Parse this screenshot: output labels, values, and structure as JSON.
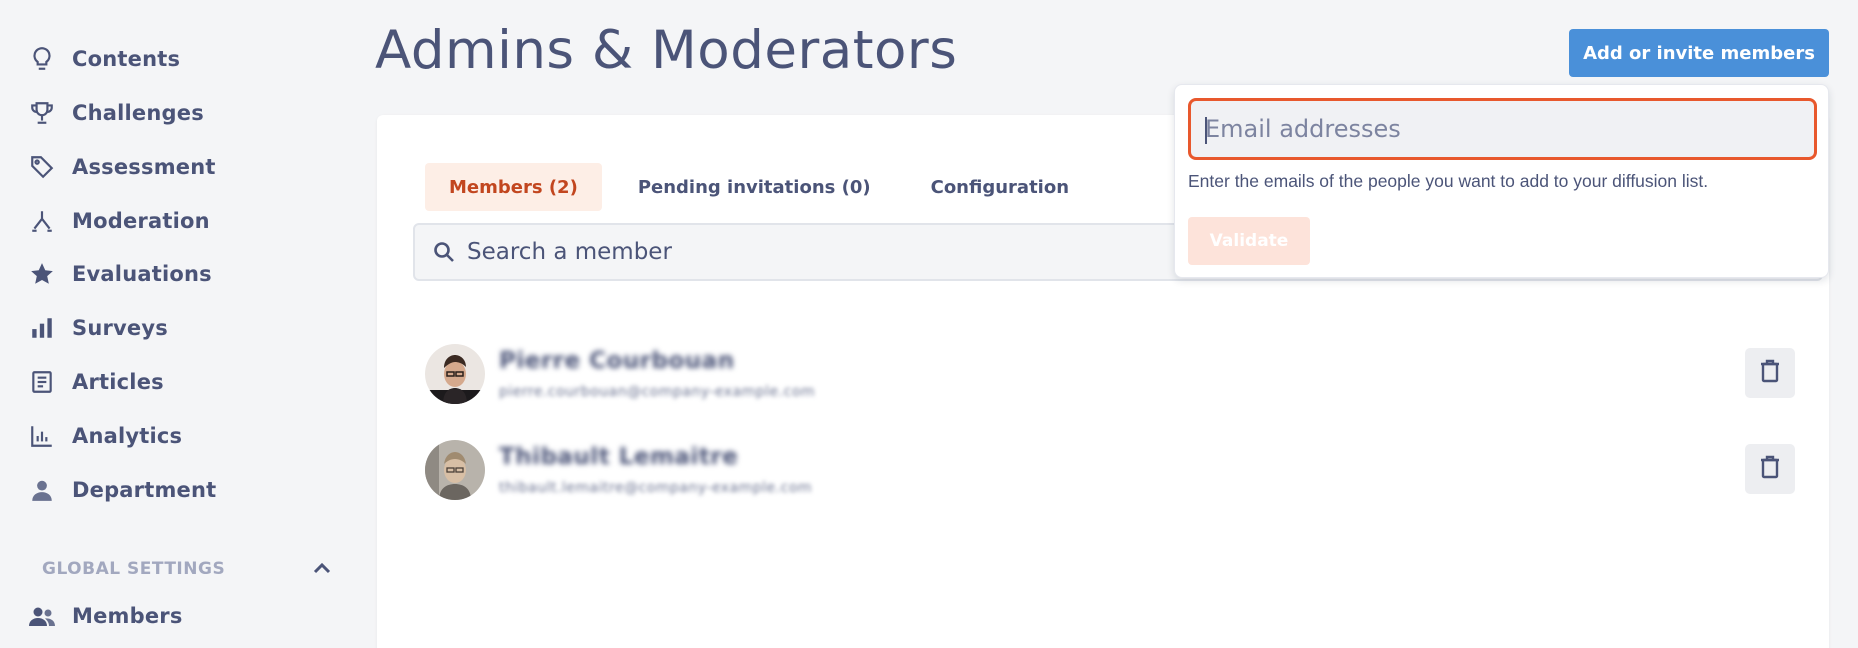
{
  "sidebar": {
    "items": [
      {
        "label": "Contents",
        "icon": "lightbulb-icon"
      },
      {
        "label": "Challenges",
        "icon": "trophy-icon"
      },
      {
        "label": "Assessment",
        "icon": "tag-icon"
      },
      {
        "label": "Moderation",
        "icon": "fork-icon"
      },
      {
        "label": "Evaluations",
        "icon": "star-icon"
      },
      {
        "label": "Surveys",
        "icon": "bar-chart-icon"
      },
      {
        "label": "Articles",
        "icon": "article-icon"
      },
      {
        "label": "Analytics",
        "icon": "analytics-icon"
      },
      {
        "label": "Department",
        "icon": "person-icon"
      }
    ],
    "global_settings": {
      "label": "GLOBAL SETTINGS",
      "icon": "chevron-up-icon",
      "items": [
        {
          "label": "Members",
          "icon": "people-icon"
        }
      ]
    }
  },
  "header": {
    "title": "Admins & Moderators",
    "add_button": "Add or invite members"
  },
  "tabs": [
    {
      "label": "Members (2)",
      "active": true
    },
    {
      "label": "Pending invitations (0)",
      "active": false
    },
    {
      "label": "Configuration",
      "active": false
    }
  ],
  "search": {
    "placeholder": "Search a member"
  },
  "members": [
    {
      "name": "Pierre Courbouan",
      "email": "pierre.courbouan@company-example.com"
    },
    {
      "name": "Thibault Lemaitre",
      "email": "thibault.lemaitre@company-example.com"
    }
  ],
  "popover": {
    "input_placeholder": "Email addresses",
    "help_text": "Enter the emails of the people you want to add to your diffusion list.",
    "validate_label": "Validate"
  },
  "colors": {
    "primary_button": "#4a90d9",
    "accent": "#e8582d",
    "active_tab_bg": "#fdeee6",
    "text": "#4b5478"
  }
}
